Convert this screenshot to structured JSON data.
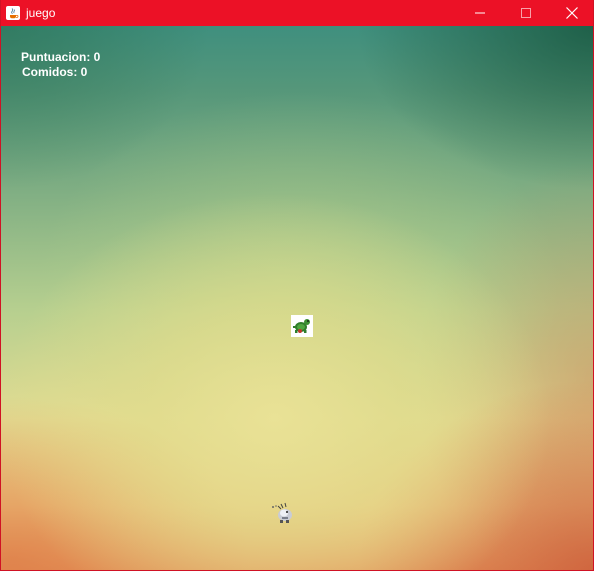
{
  "window": {
    "title": "juego",
    "title_bar_color": "#ec1126",
    "controls": [
      "minimize-icon",
      "maximize-icon",
      "close-icon"
    ]
  },
  "hud": {
    "score_label": "Puntuacion: 0",
    "eaten_label": "Comidos: 0"
  },
  "sprites": [
    {
      "name": "turtle-sprite",
      "icon": "green-turtle"
    },
    {
      "name": "player-creature-sprite",
      "icon": "gray-creature"
    }
  ]
}
